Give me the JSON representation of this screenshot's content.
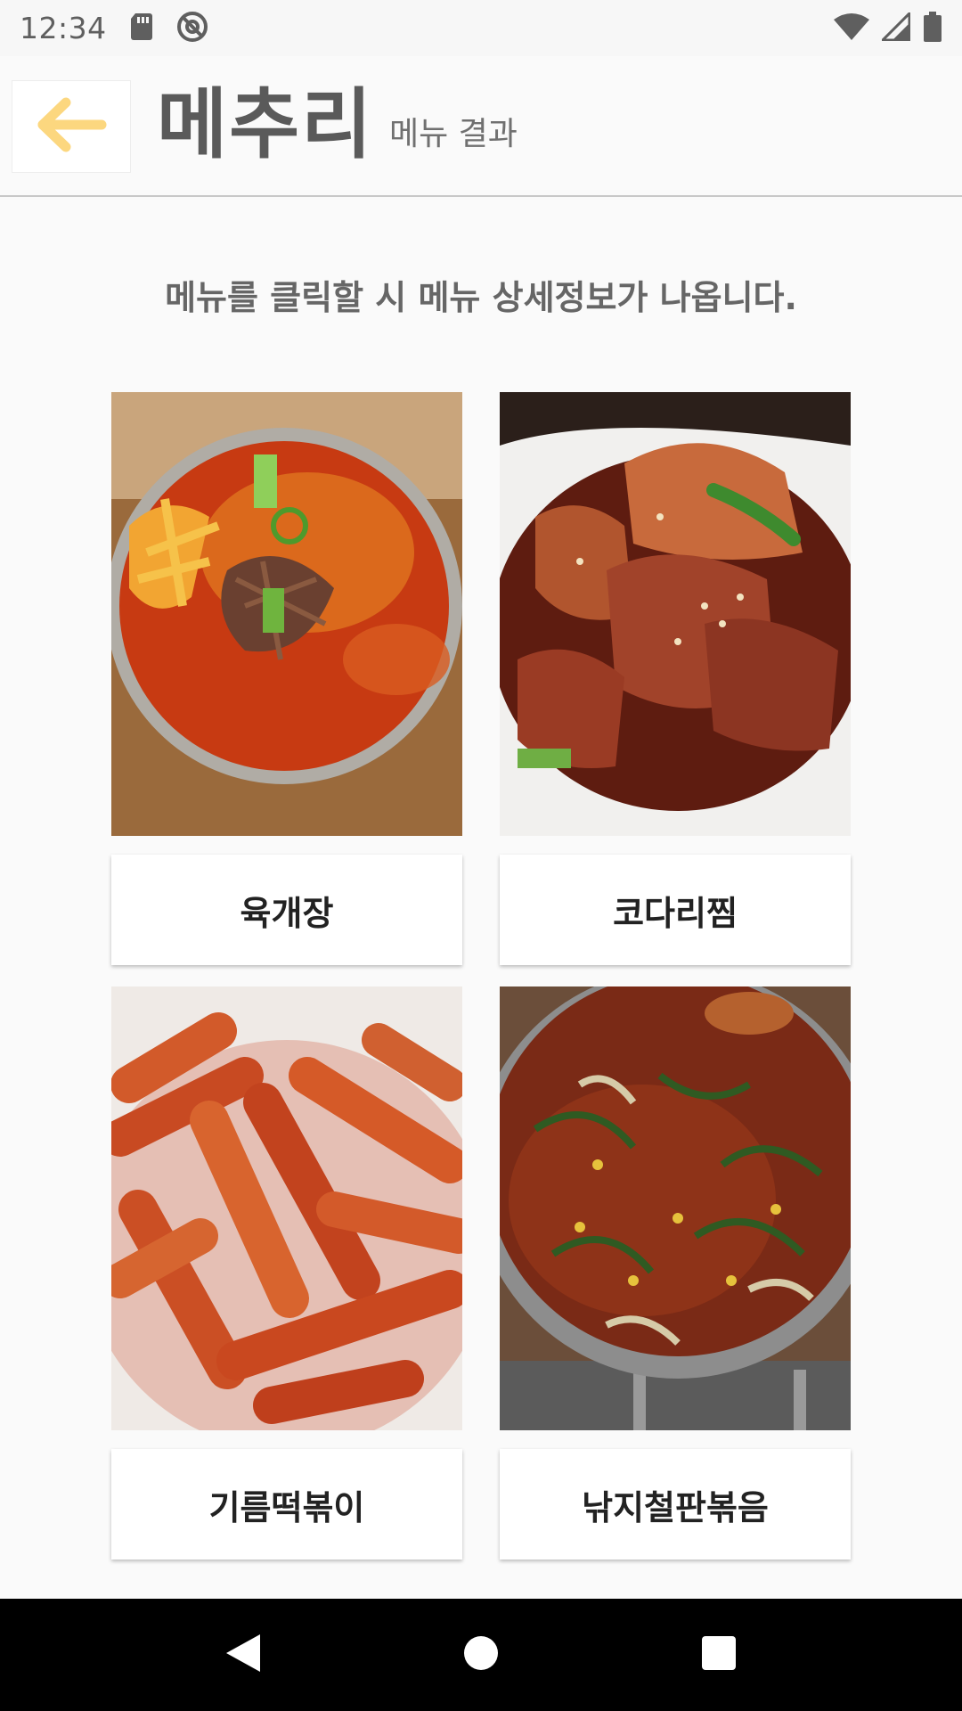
{
  "status_bar": {
    "time": "12:34",
    "icons": [
      "sd-card-icon",
      "no-disturb-icon",
      "wifi-icon",
      "signal-icon",
      "battery-icon"
    ]
  },
  "header": {
    "back_icon": "arrow-left-icon",
    "title": "메추리",
    "subtitle": "메뉴 결과",
    "accent_color": "#fcd77f"
  },
  "instruction": "메뉴를 클릭할 시 메뉴 상세정보가 나옵니다.",
  "menus": [
    {
      "name": "육개장",
      "image": "yukgaejang-photo"
    },
    {
      "name": "코다리찜",
      "image": "kodari-jjim-photo"
    },
    {
      "name": "기름떡볶이",
      "image": "gireum-tteokbokki-photo"
    },
    {
      "name": "낚지철판볶음",
      "image": "nakji-cheolpan-bokkeum-photo"
    }
  ],
  "nav_bar": {
    "icons": [
      "back-triangle-icon",
      "home-circle-icon",
      "recents-square-icon"
    ]
  }
}
